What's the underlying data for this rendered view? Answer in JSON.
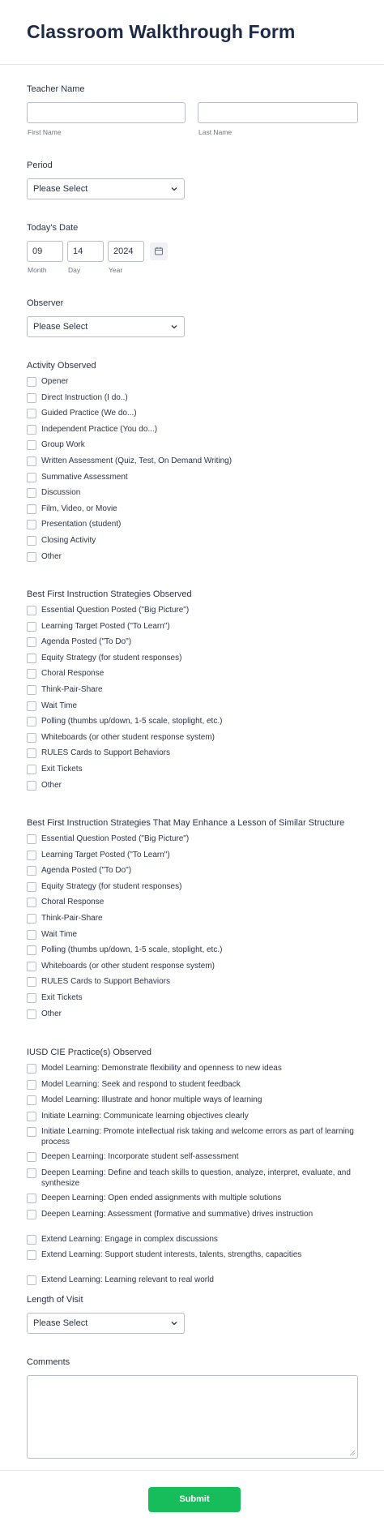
{
  "form_title": "Classroom Walkthrough Form",
  "teacher": {
    "label": "Teacher Name",
    "first_sub": "First Name",
    "last_sub": "Last Name"
  },
  "period": {
    "label": "Period",
    "value": "Please Select"
  },
  "date": {
    "label": "Today's Date",
    "month": "09",
    "day": "14",
    "year": "2024",
    "month_sub": "Month",
    "day_sub": "Day",
    "year_sub": "Year"
  },
  "observer": {
    "label": "Observer",
    "value": "Please Select"
  },
  "activity": {
    "label": "Activity Observed",
    "options": [
      "Opener",
      "Direct Instruction (I do..)",
      "Guided Practice (We do...)",
      "Independent Practice (You do...)",
      "Group Work",
      "Written Assessment (Quiz, Test, On Demand Writing)",
      "Summative Assessment",
      "Discussion",
      "Film, Video, or Movie",
      "Presentation (student)",
      "Closing Activity",
      "Other"
    ]
  },
  "strategies_observed": {
    "label": "Best First Instruction Strategies Observed",
    "options": [
      "Essential Question Posted (\"Big Picture\")",
      "Learning Target Posted (\"To Learn\")",
      "Agenda Posted (\"To Do\")",
      "Equity Strategy (for student responses)",
      "Choral Response",
      "Think-Pair-Share",
      "Wait Time",
      "Polling (thumbs up/down, 1-5 scale, stoplight, etc.)",
      "Whiteboards (or other student response system)",
      "RULES Cards to Support Behaviors",
      "Exit Tickets",
      "Other"
    ]
  },
  "strategies_enhance": {
    "label": "Best First Instruction Strategies That May Enhance a Lesson of Similar Structure",
    "options": [
      "Essential Question Posted (\"Big Picture\")",
      "Learning Target Posted (\"To Learn\")",
      "Agenda Posted (\"To Do\")",
      "Equity Strategy (for student responses)",
      "Choral Response",
      "Think-Pair-Share",
      "Wait Time",
      "Polling (thumbs up/down, 1-5 scale, stoplight, etc.)",
      "Whiteboards (or other student response system)",
      "RULES Cards to Support Behaviors",
      "Exit Tickets",
      "Other"
    ]
  },
  "cie": {
    "label": "IUSD CIE Practice(s) Observed",
    "options": [
      "Model Learning: Demonstrate flexibility and openness to new ideas",
      "Model Learning: Seek and respond to student feedback",
      "Model Learning: Illustrate and honor multiple ways of learning",
      "Initiate Learning: Communicate learning objectives clearly",
      "Initiate Learning: Promote intellectual risk taking and welcome errors as part of learning process",
      "Deepen Learning: Incorporate student self-assessment",
      "Deepen Learning: Define and teach skills to question, analyze, interpret, evaluate, and synthesize",
      "Deepen Learning: Open ended assignments with multiple solutions",
      "Deepen Learning: Assessment (formative and summative) drives instruction",
      "Extend Learning: Engage in complex discussions",
      "Extend Learning: Support student interests, talents, strengths, capacities",
      "Extend Learning: Learning relevant to real world"
    ]
  },
  "length": {
    "label": "Length of Visit",
    "value": "Please Select"
  },
  "comments": {
    "label": "Comments"
  },
  "submit_label": "Submit"
}
